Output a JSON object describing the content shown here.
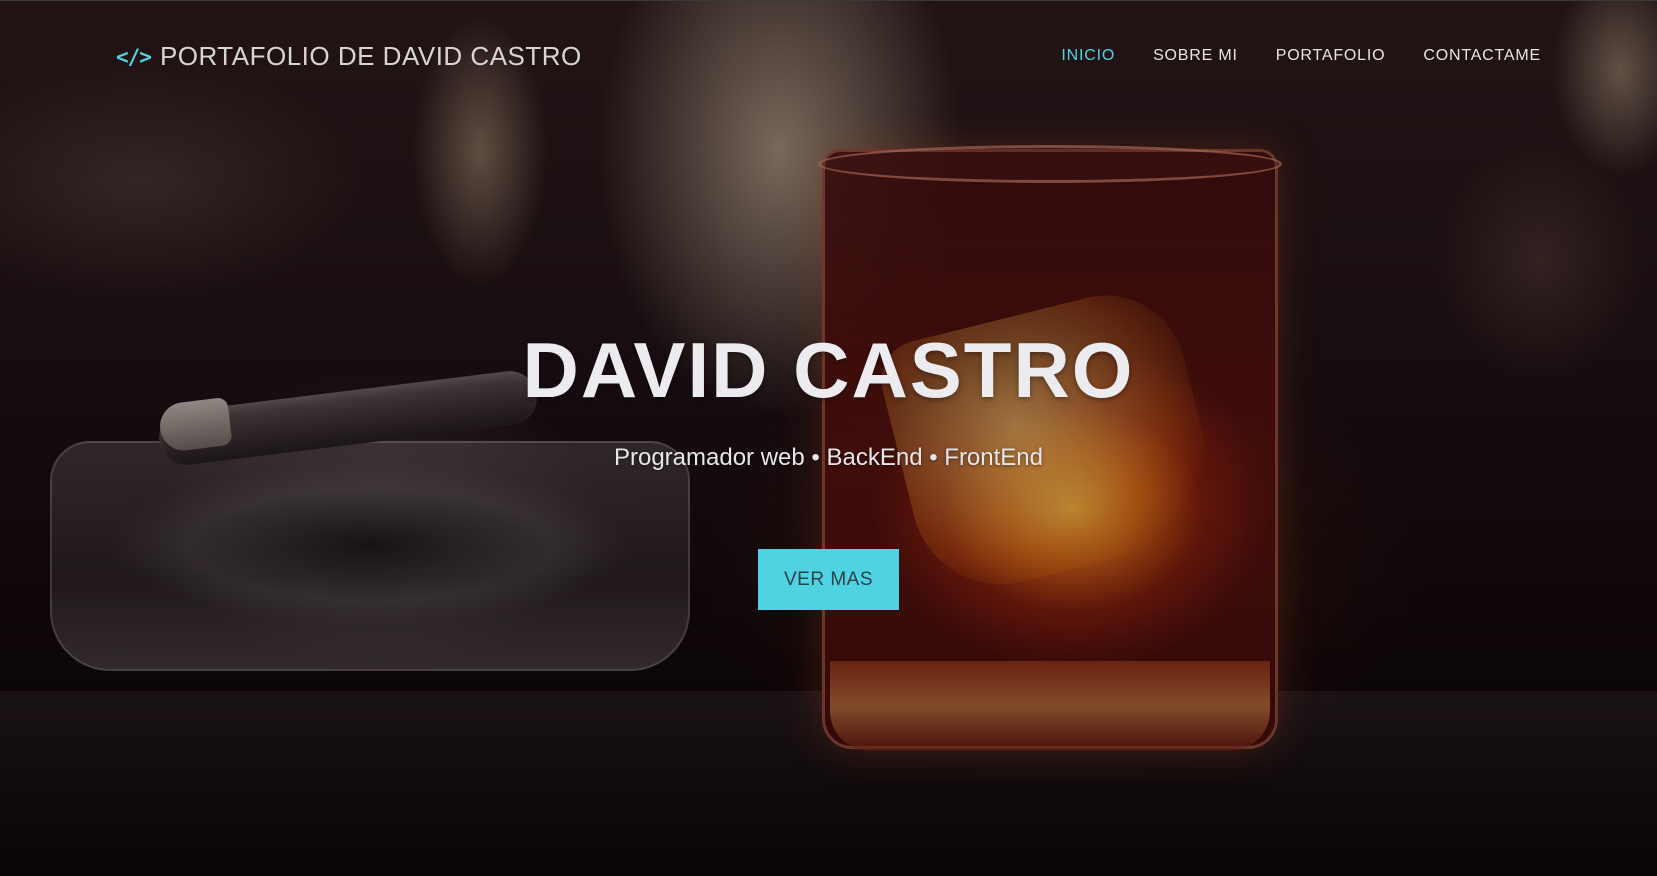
{
  "navbar": {
    "brand_icon": "</>",
    "brand_label": "PORTAFOLIO DE DAVID CASTRO",
    "links": [
      {
        "label": "INICIO",
        "active": true
      },
      {
        "label": "SOBRE MI",
        "active": false
      },
      {
        "label": "PORTAFOLIO",
        "active": false
      },
      {
        "label": "CONTACTAME",
        "active": false
      }
    ]
  },
  "hero": {
    "title": "DAVID CASTRO",
    "subtitle": "Programador web • BackEnd • FrontEnd",
    "cta_label": "VER MAS"
  },
  "colors": {
    "accent": "#4fd3e3",
    "button_text": "#2d4148",
    "title_text": "#ecebef"
  },
  "icons": {
    "brand": "code-icon"
  }
}
